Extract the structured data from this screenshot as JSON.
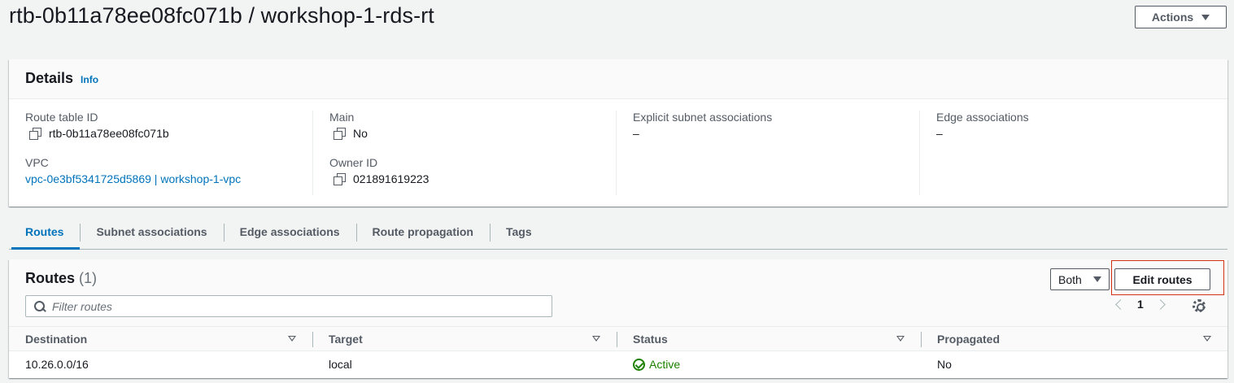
{
  "page": {
    "title": "rtb-0b11a78ee08fc071b / workshop-1-rds-rt",
    "actions_label": "Actions"
  },
  "details": {
    "title": "Details",
    "info_label": "Info",
    "route_table_id_label": "Route table ID",
    "route_table_id": "rtb-0b11a78ee08fc071b",
    "vpc_label": "VPC",
    "vpc_value": "vpc-0e3bf5341725d5869 | workshop-1-vpc",
    "main_label": "Main",
    "main_value": "No",
    "owner_id_label": "Owner ID",
    "owner_id": "021891619223",
    "explicit_subnet_label": "Explicit subnet associations",
    "explicit_subnet_value": "–",
    "edge_assoc_label": "Edge associations",
    "edge_assoc_value": "–"
  },
  "tabs": [
    {
      "label": "Routes",
      "active": true
    },
    {
      "label": "Subnet associations",
      "active": false
    },
    {
      "label": "Edge associations",
      "active": false
    },
    {
      "label": "Route propagation",
      "active": false
    },
    {
      "label": "Tags",
      "active": false
    }
  ],
  "routes": {
    "title": "Routes",
    "count": "(1)",
    "filter_select": "Both",
    "edit_label": "Edit routes",
    "filter_placeholder": "Filter routes",
    "page_number": "1",
    "columns": [
      "Destination",
      "Target",
      "Status",
      "Propagated"
    ],
    "rows": [
      {
        "destination": "10.26.0.0/16",
        "target": "local",
        "status": "Active",
        "propagated": "No"
      }
    ]
  },
  "colors": {
    "link": "#0073bb",
    "success": "#1d8102",
    "highlight": "#d13212"
  }
}
